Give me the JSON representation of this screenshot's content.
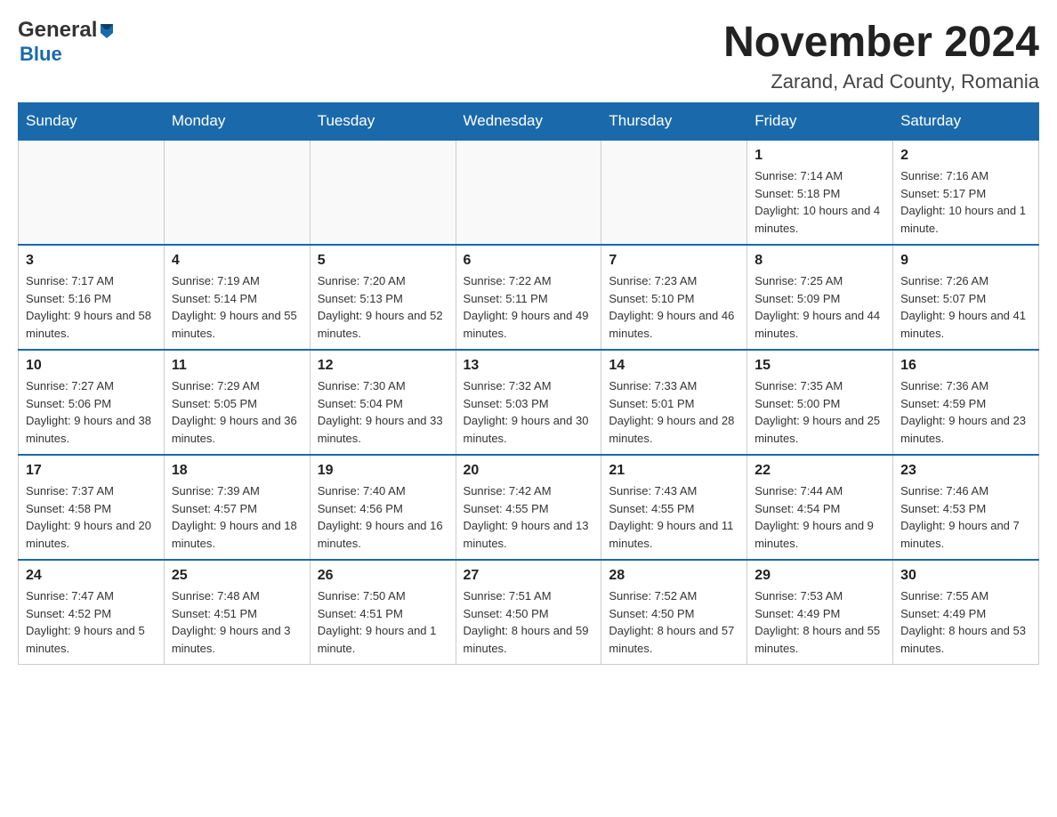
{
  "header": {
    "logo_general": "General",
    "logo_blue": "Blue",
    "month_title": "November 2024",
    "location": "Zarand, Arad County, Romania"
  },
  "days_of_week": [
    "Sunday",
    "Monday",
    "Tuesday",
    "Wednesday",
    "Thursday",
    "Friday",
    "Saturday"
  ],
  "weeks": [
    {
      "days": [
        {
          "num": "",
          "info": ""
        },
        {
          "num": "",
          "info": ""
        },
        {
          "num": "",
          "info": ""
        },
        {
          "num": "",
          "info": ""
        },
        {
          "num": "",
          "info": ""
        },
        {
          "num": "1",
          "info": "Sunrise: 7:14 AM\nSunset: 5:18 PM\nDaylight: 10 hours and 4 minutes."
        },
        {
          "num": "2",
          "info": "Sunrise: 7:16 AM\nSunset: 5:17 PM\nDaylight: 10 hours and 1 minute."
        }
      ]
    },
    {
      "days": [
        {
          "num": "3",
          "info": "Sunrise: 7:17 AM\nSunset: 5:16 PM\nDaylight: 9 hours and 58 minutes."
        },
        {
          "num": "4",
          "info": "Sunrise: 7:19 AM\nSunset: 5:14 PM\nDaylight: 9 hours and 55 minutes."
        },
        {
          "num": "5",
          "info": "Sunrise: 7:20 AM\nSunset: 5:13 PM\nDaylight: 9 hours and 52 minutes."
        },
        {
          "num": "6",
          "info": "Sunrise: 7:22 AM\nSunset: 5:11 PM\nDaylight: 9 hours and 49 minutes."
        },
        {
          "num": "7",
          "info": "Sunrise: 7:23 AM\nSunset: 5:10 PM\nDaylight: 9 hours and 46 minutes."
        },
        {
          "num": "8",
          "info": "Sunrise: 7:25 AM\nSunset: 5:09 PM\nDaylight: 9 hours and 44 minutes."
        },
        {
          "num": "9",
          "info": "Sunrise: 7:26 AM\nSunset: 5:07 PM\nDaylight: 9 hours and 41 minutes."
        }
      ]
    },
    {
      "days": [
        {
          "num": "10",
          "info": "Sunrise: 7:27 AM\nSunset: 5:06 PM\nDaylight: 9 hours and 38 minutes."
        },
        {
          "num": "11",
          "info": "Sunrise: 7:29 AM\nSunset: 5:05 PM\nDaylight: 9 hours and 36 minutes."
        },
        {
          "num": "12",
          "info": "Sunrise: 7:30 AM\nSunset: 5:04 PM\nDaylight: 9 hours and 33 minutes."
        },
        {
          "num": "13",
          "info": "Sunrise: 7:32 AM\nSunset: 5:03 PM\nDaylight: 9 hours and 30 minutes."
        },
        {
          "num": "14",
          "info": "Sunrise: 7:33 AM\nSunset: 5:01 PM\nDaylight: 9 hours and 28 minutes."
        },
        {
          "num": "15",
          "info": "Sunrise: 7:35 AM\nSunset: 5:00 PM\nDaylight: 9 hours and 25 minutes."
        },
        {
          "num": "16",
          "info": "Sunrise: 7:36 AM\nSunset: 4:59 PM\nDaylight: 9 hours and 23 minutes."
        }
      ]
    },
    {
      "days": [
        {
          "num": "17",
          "info": "Sunrise: 7:37 AM\nSunset: 4:58 PM\nDaylight: 9 hours and 20 minutes."
        },
        {
          "num": "18",
          "info": "Sunrise: 7:39 AM\nSunset: 4:57 PM\nDaylight: 9 hours and 18 minutes."
        },
        {
          "num": "19",
          "info": "Sunrise: 7:40 AM\nSunset: 4:56 PM\nDaylight: 9 hours and 16 minutes."
        },
        {
          "num": "20",
          "info": "Sunrise: 7:42 AM\nSunset: 4:55 PM\nDaylight: 9 hours and 13 minutes."
        },
        {
          "num": "21",
          "info": "Sunrise: 7:43 AM\nSunset: 4:55 PM\nDaylight: 9 hours and 11 minutes."
        },
        {
          "num": "22",
          "info": "Sunrise: 7:44 AM\nSunset: 4:54 PM\nDaylight: 9 hours and 9 minutes."
        },
        {
          "num": "23",
          "info": "Sunrise: 7:46 AM\nSunset: 4:53 PM\nDaylight: 9 hours and 7 minutes."
        }
      ]
    },
    {
      "days": [
        {
          "num": "24",
          "info": "Sunrise: 7:47 AM\nSunset: 4:52 PM\nDaylight: 9 hours and 5 minutes."
        },
        {
          "num": "25",
          "info": "Sunrise: 7:48 AM\nSunset: 4:51 PM\nDaylight: 9 hours and 3 minutes."
        },
        {
          "num": "26",
          "info": "Sunrise: 7:50 AM\nSunset: 4:51 PM\nDaylight: 9 hours and 1 minute."
        },
        {
          "num": "27",
          "info": "Sunrise: 7:51 AM\nSunset: 4:50 PM\nDaylight: 8 hours and 59 minutes."
        },
        {
          "num": "28",
          "info": "Sunrise: 7:52 AM\nSunset: 4:50 PM\nDaylight: 8 hours and 57 minutes."
        },
        {
          "num": "29",
          "info": "Sunrise: 7:53 AM\nSunset: 4:49 PM\nDaylight: 8 hours and 55 minutes."
        },
        {
          "num": "30",
          "info": "Sunrise: 7:55 AM\nSunset: 4:49 PM\nDaylight: 8 hours and 53 minutes."
        }
      ]
    }
  ]
}
